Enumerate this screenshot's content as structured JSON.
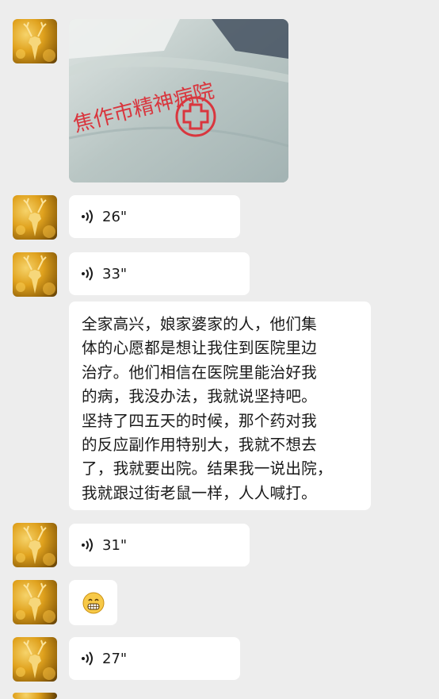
{
  "messages": {
    "photo": {
      "caption_text": "焦作市精神病院",
      "icon": "red-cross-logo"
    },
    "voice1": {
      "duration": "26\""
    },
    "voice2": {
      "duration": "33\""
    },
    "text": {
      "lines": [
        "全家高兴，娘家婆家的人，他们集",
        "体的心愿都是想让我住到医院里边",
        "治疗。他们相信在医院里能治好我",
        "的病，我没办法，我就说坚持吧。",
        "坚持了四五天的时候，那个药对我",
        "的反应副作用特别大，我就不想去",
        "了，我就要出院。结果我一说出院，",
        "我就跟过街老鼠一样，人人喊打。"
      ]
    },
    "voice3": {
      "duration": "31\""
    },
    "emoji": {
      "icon": "grin-emoji"
    },
    "voice4": {
      "duration": "27\""
    }
  },
  "colors": {
    "background": "#ededed",
    "bubble": "#ffffff",
    "stamp_red": "#d9363e"
  }
}
